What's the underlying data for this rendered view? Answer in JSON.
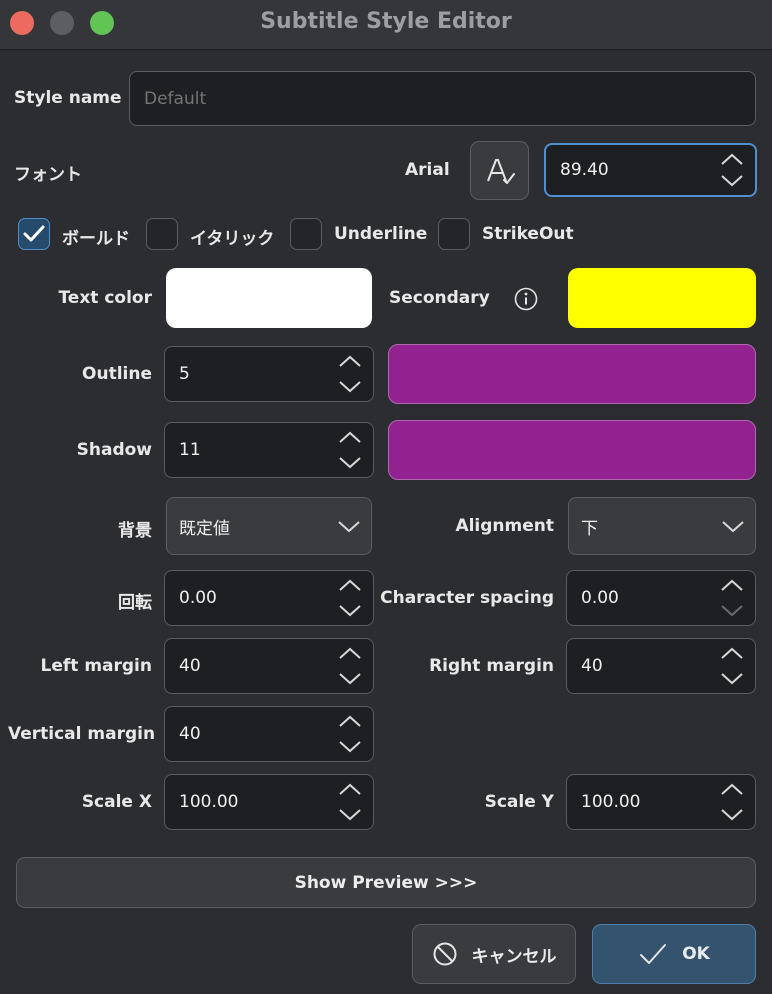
{
  "window": {
    "title": "Subtitle Style Editor"
  },
  "style_name": {
    "label": "Style name",
    "placeholder": "Default"
  },
  "font": {
    "label": "フォント",
    "name": "Arial",
    "size": "89.40"
  },
  "checkboxes": [
    {
      "label": "ボールド",
      "checked": true
    },
    {
      "label": "イタリック",
      "checked": false
    },
    {
      "label": "Underline",
      "checked": false
    },
    {
      "label": "StrikeOut",
      "checked": false
    }
  ],
  "colors": {
    "text_label": "Text color",
    "text": "#ffffff",
    "secondary_label": "Secondary",
    "secondary": "#ffff00",
    "outline": "#92228f",
    "shadow": "#92228f"
  },
  "outline": {
    "label": "Outline",
    "value": "5"
  },
  "shadow": {
    "label": "Shadow",
    "value": "11"
  },
  "background": {
    "label": "背景",
    "value": "既定値"
  },
  "alignment": {
    "label": "Alignment",
    "value": "下"
  },
  "rotation": {
    "label": "回転",
    "value": "0.00"
  },
  "char_spacing": {
    "label": "Character spacing",
    "value": "0.00"
  },
  "left_margin": {
    "label": "Left margin",
    "value": "40"
  },
  "right_margin": {
    "label": "Right margin",
    "value": "40"
  },
  "vertical_margin": {
    "label": "Vertical margin",
    "value": "40"
  },
  "scale_x": {
    "label": "Scale X",
    "value": "100.00"
  },
  "scale_y": {
    "label": "Scale Y",
    "value": "100.00"
  },
  "buttons": {
    "preview": "Show Preview >>>",
    "cancel": "キャンセル",
    "ok": "OK"
  }
}
